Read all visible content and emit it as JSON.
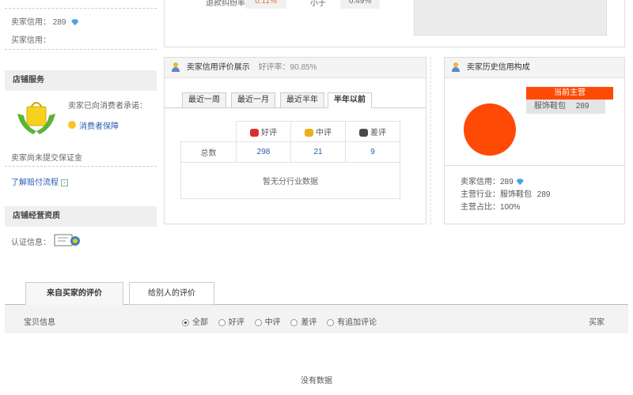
{
  "left": {
    "seller_credit_label": "卖家信用：",
    "seller_credit_value": "289",
    "buyer_credit_label": "买家信用：",
    "shop_service_title": "店铺服务",
    "promise_text": "卖家已向消费者承诺：",
    "protection_link": "消费者保障",
    "no_deposit_text": "卖家尚未提交保证金",
    "compensation_link": "了解赔付流程",
    "shop_qualification_title": "店铺经营资质",
    "certification_label": "认证信息："
  },
  "top": {
    "refund_rate_label": "退款纠纷率：",
    "refund_rate_value": "0.11%",
    "lower_than_label": "小于",
    "lower_than_value": "0.49%"
  },
  "ratings": {
    "title": "卖家信用评价展示",
    "positive_rate": "好评率：90.85%",
    "tabs": [
      "最近一周",
      "最近一月",
      "最近半年",
      "半年以前"
    ],
    "active_tab_index": 3,
    "headers": [
      "好评",
      "中评",
      "差评"
    ],
    "row_label": "总数",
    "values": [
      "298",
      "21",
      "9"
    ],
    "no_data": "暂无分行业数据"
  },
  "history": {
    "title": "卖家历史信用构成",
    "legend_title": "当前主营",
    "legend_category": "服饰鞋包",
    "legend_value": "289",
    "credit_label": "卖家信用：",
    "credit_value": "289",
    "industry_label": "主营行业：",
    "industry_value": "服饰鞋包",
    "industry_count": "289",
    "share_label": "主营占比：",
    "share_value": "100%",
    "pie_share": 1.0,
    "pie_color": "#ff4a05"
  },
  "reviews": {
    "tab_from_buyers": "来自买家的评价",
    "tab_to_others": "给别人的评价",
    "item_info": "宝贝信息",
    "filters": [
      "全部",
      "好评",
      "中评",
      "差评",
      "有追加评论"
    ],
    "selected_filter_index": 0,
    "buyer_col": "买家",
    "empty": "没有数据"
  }
}
